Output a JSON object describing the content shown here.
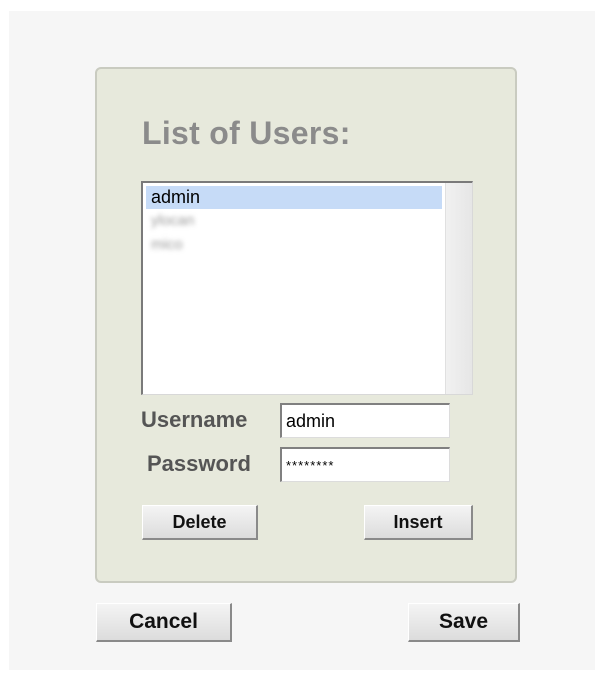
{
  "dialog": {
    "title": "List of Users:"
  },
  "users_list": {
    "items": [
      {
        "label": "admin",
        "selected": true,
        "blurred": false
      },
      {
        "label": "ylocan",
        "selected": false,
        "blurred": true
      },
      {
        "label": "mico",
        "selected": false,
        "blurred": true
      }
    ]
  },
  "form": {
    "username_label": "Username",
    "username_value": "admin",
    "password_label": "Password",
    "password_value": "********"
  },
  "buttons": {
    "delete": "Delete",
    "insert": "Insert",
    "cancel": "Cancel",
    "save": "Save"
  },
  "colors": {
    "panel_background": "#e7e9dc",
    "selection_highlight": "#c6dbf7",
    "title_color": "#8b8b8b"
  }
}
